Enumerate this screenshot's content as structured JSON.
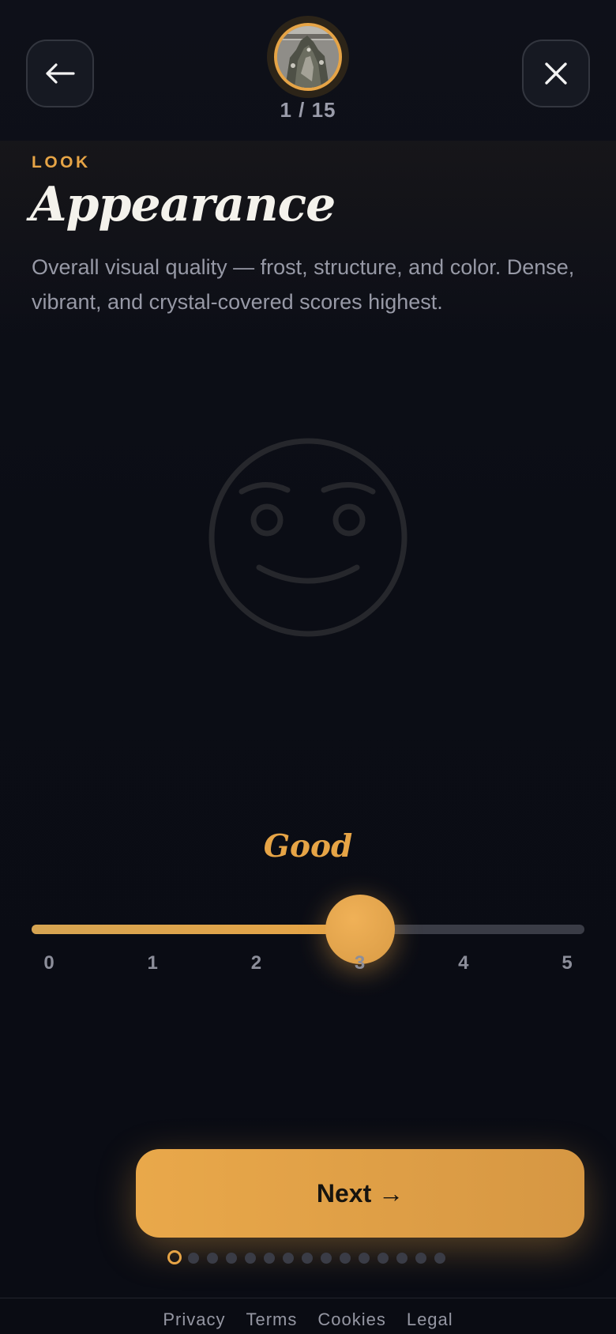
{
  "header": {
    "back_icon": "arrow-left-icon",
    "close_icon": "close-icon",
    "progress_counter": "1 / 15",
    "avatar_image": "cannabis-bud-photo"
  },
  "question": {
    "category": "LOOK",
    "title": "Appearance",
    "description": "Overall visual quality — frost, structure, and color. Dense, vibrant, and crystal-covered scores highest."
  },
  "illustration": {
    "icon": "smiling-face-icon"
  },
  "rating": {
    "label": "Good",
    "value": 3,
    "min": 0,
    "max": 5,
    "ticks": [
      "0",
      "1",
      "2",
      "3",
      "4",
      "5"
    ]
  },
  "actions": {
    "next_label": "Next →"
  },
  "progress": {
    "current_step": 1,
    "total_steps": 15
  },
  "footer": {
    "links": [
      "Privacy",
      "Terms",
      "Cookies",
      "Legal"
    ]
  },
  "colors": {
    "accent": "#e6a446",
    "background": "#0b0d15",
    "muted_text": "#9799a6"
  }
}
